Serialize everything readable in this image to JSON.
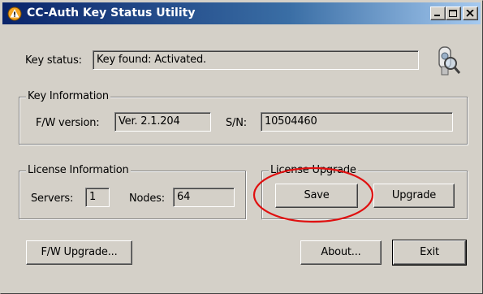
{
  "window": {
    "title": "CC-Auth Key Status Utility"
  },
  "key_status": {
    "label": "Key status:",
    "value": "Key found: Activated."
  },
  "key_information": {
    "group_title": "Key Information",
    "fw_label": "F/W version:",
    "fw_value": "Ver. 2.1.204",
    "sn_label": "S/N:",
    "sn_value": "10504460"
  },
  "license_information": {
    "group_title": "License Information",
    "servers_label": "Servers:",
    "servers_value": "1",
    "nodes_label": "Nodes:",
    "nodes_value": "64"
  },
  "license_upgrade": {
    "group_title": "License Upgrade",
    "save_label": "Save",
    "upgrade_label": "Upgrade"
  },
  "footer": {
    "fw_upgrade_label": "F/W Upgrade...",
    "about_label": "About...",
    "exit_label": "Exit"
  },
  "icons": {
    "app_icon": "warning-triangle-icon",
    "key_status_icon": "usb-key-magnifier-icon"
  },
  "colors": {
    "titlebar_start": "#0a246a",
    "titlebar_end": "#a6caf0",
    "annotation_circle": "#e01010"
  }
}
